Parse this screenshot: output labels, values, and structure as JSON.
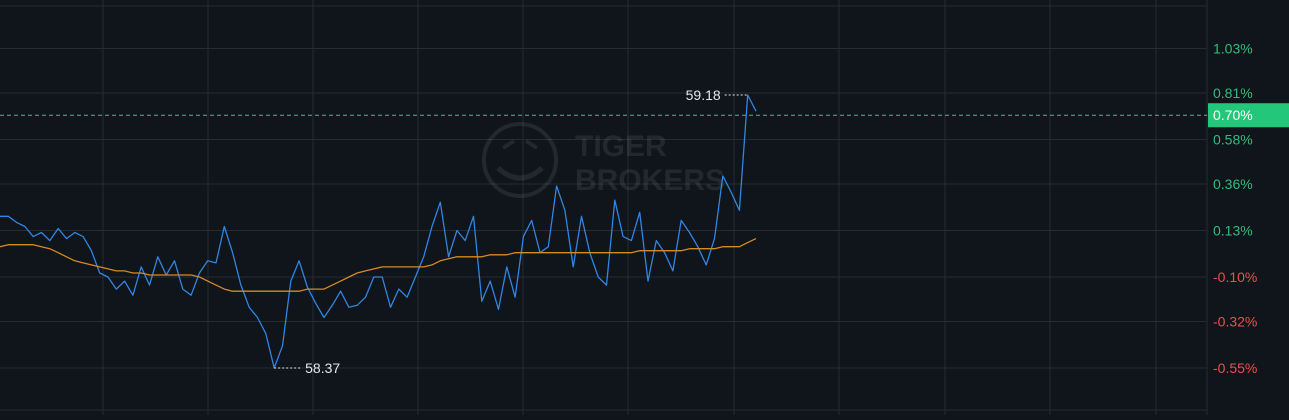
{
  "watermark": "TIGER BROKERS",
  "colors": {
    "background": "#10141b",
    "grid": "#262b35",
    "price_line": "#2f86e3",
    "average_line": "#d58a22",
    "positive": "#2fbf7a",
    "negative": "#e4544c",
    "current_badge": "#22c77a",
    "reference_line": "#3bbf9a",
    "annotation": "#e6e6e6"
  },
  "chart_data": {
    "type": "line",
    "y_axis": {
      "unit": "%",
      "ticks": [
        "1.03%",
        "0.81%",
        "0.58%",
        "0.36%",
        "0.13%",
        "-0.10%",
        "-0.32%",
        "-0.55%"
      ],
      "tick_values": [
        1.03,
        0.81,
        0.58,
        0.36,
        0.13,
        -0.1,
        -0.32,
        -0.55
      ],
      "range": [
        -0.55,
        1.03
      ]
    },
    "current_value_label": "0.70%",
    "current_value": 0.7,
    "annotations": {
      "high_label": "59.18",
      "high_index": 90,
      "low_label": "58.37",
      "low_index": 33
    },
    "series": [
      {
        "key": "price",
        "values": [
          0.2,
          0.2,
          0.17,
          0.15,
          0.1,
          0.12,
          0.08,
          0.14,
          0.09,
          0.12,
          0.1,
          0.03,
          -0.08,
          -0.1,
          -0.16,
          -0.12,
          -0.19,
          -0.05,
          -0.14,
          0.0,
          -0.09,
          -0.02,
          -0.16,
          -0.19,
          -0.08,
          -0.02,
          -0.03,
          0.15,
          0.02,
          -0.14,
          -0.25,
          -0.3,
          -0.38,
          -0.55,
          -0.44,
          -0.12,
          -0.02,
          -0.15,
          -0.23,
          -0.3,
          -0.24,
          -0.17,
          -0.25,
          -0.24,
          -0.2,
          -0.1,
          -0.1,
          -0.25,
          -0.16,
          -0.2,
          -0.1,
          0.0,
          0.15,
          0.27,
          0.0,
          0.13,
          0.08,
          0.2,
          -0.22,
          -0.12,
          -0.26,
          -0.05,
          -0.2,
          0.1,
          0.18,
          0.02,
          0.05,
          0.35,
          0.23,
          -0.05,
          0.2,
          0.02,
          -0.1,
          -0.14,
          0.28,
          0.1,
          0.08,
          0.22,
          -0.12,
          0.08,
          0.02,
          -0.07,
          0.18,
          0.12,
          0.05,
          -0.04,
          0.09,
          0.4,
          0.32,
          0.23,
          0.8,
          0.72
        ],
        "style": "solid"
      },
      {
        "key": "average",
        "values": [
          0.05,
          0.06,
          0.06,
          0.06,
          0.06,
          0.05,
          0.04,
          0.02,
          0.0,
          -0.02,
          -0.03,
          -0.04,
          -0.05,
          -0.06,
          -0.07,
          -0.07,
          -0.08,
          -0.08,
          -0.09,
          -0.09,
          -0.09,
          -0.09,
          -0.09,
          -0.09,
          -0.1,
          -0.12,
          -0.14,
          -0.16,
          -0.17,
          -0.17,
          -0.17,
          -0.17,
          -0.17,
          -0.17,
          -0.17,
          -0.17,
          -0.17,
          -0.16,
          -0.16,
          -0.16,
          -0.14,
          -0.12,
          -0.1,
          -0.08,
          -0.07,
          -0.06,
          -0.05,
          -0.05,
          -0.05,
          -0.05,
          -0.05,
          -0.05,
          -0.04,
          -0.02,
          -0.01,
          0.0,
          0.0,
          0.0,
          0.0,
          0.01,
          0.01,
          0.01,
          0.02,
          0.02,
          0.02,
          0.02,
          0.02,
          0.02,
          0.02,
          0.02,
          0.02,
          0.02,
          0.02,
          0.02,
          0.02,
          0.02,
          0.02,
          0.03,
          0.03,
          0.03,
          0.03,
          0.03,
          0.03,
          0.04,
          0.04,
          0.04,
          0.04,
          0.05,
          0.05,
          0.05,
          0.07,
          0.09
        ],
        "style": "solid"
      }
    ],
    "grid": true
  }
}
